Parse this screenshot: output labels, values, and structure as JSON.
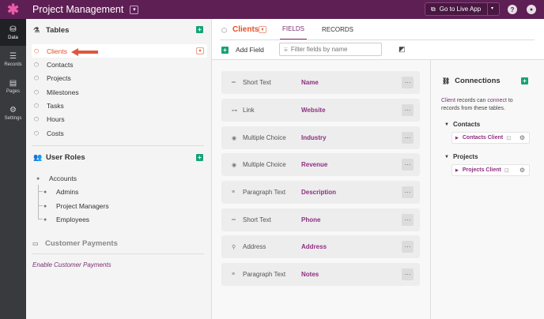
{
  "app": {
    "title": "Project Management",
    "go_live_label": "Go to Live App",
    "help_icon": "?"
  },
  "leftnav": {
    "items": [
      {
        "label": "Data",
        "icon": "data-icon"
      },
      {
        "label": "Records",
        "icon": "records-icon"
      },
      {
        "label": "Pages",
        "icon": "pages-icon"
      },
      {
        "label": "Settings",
        "icon": "settings-icon"
      }
    ],
    "active": "Data"
  },
  "tables": {
    "heading": "Tables",
    "items": [
      "Clients",
      "Contacts",
      "Projects",
      "Milestones",
      "Tasks",
      "Hours",
      "Costs"
    ],
    "selected": "Clients"
  },
  "user_roles": {
    "heading": "User Roles",
    "parent": "Accounts",
    "children": [
      "Admins",
      "Project Managers",
      "Employees"
    ]
  },
  "customer_payments": {
    "heading": "Customer Payments",
    "enable_link": "Enable Customer Payments"
  },
  "main": {
    "table_name": "Clients",
    "tabs": [
      {
        "label": "FIELDS",
        "active": true
      },
      {
        "label": "RECORDS",
        "active": false
      }
    ],
    "add_field_label": "Add Field",
    "filter_placeholder": "Filter fields by name",
    "more_label": "···"
  },
  "fields": [
    {
      "type": "Short Text",
      "name": "Name",
      "icon": "short-text-icon"
    },
    {
      "type": "Link",
      "name": "Website",
      "icon": "link-icon"
    },
    {
      "type": "Multiple Choice",
      "name": "Industry",
      "icon": "multiple-choice-icon"
    },
    {
      "type": "Multiple Choice",
      "name": "Revenue",
      "icon": "multiple-choice-icon"
    },
    {
      "type": "Paragraph Text",
      "name": "Description",
      "icon": "paragraph-text-icon"
    },
    {
      "type": "Short Text",
      "name": "Phone",
      "icon": "short-text-icon"
    },
    {
      "type": "Address",
      "name": "Address",
      "icon": "address-icon"
    },
    {
      "type": "Paragraph Text",
      "name": "Notes",
      "icon": "paragraph-text-icon"
    }
  ],
  "connections": {
    "heading": "Connections",
    "desc_prefix": "Client",
    "desc_mid": " records can ",
    "desc_link": "connect",
    "desc_suffix": " to records from these tables.",
    "groups": [
      {
        "table": "Contacts",
        "field": "Contacts Client"
      },
      {
        "table": "Projects",
        "field": "Projects Client"
      }
    ]
  },
  "colors": {
    "topbar": "#5e1f55",
    "leftnav": "#393a3d",
    "accent_orange": "#e74d29",
    "accent_purple": "#7b2f73",
    "add_green": "#1aa179"
  }
}
